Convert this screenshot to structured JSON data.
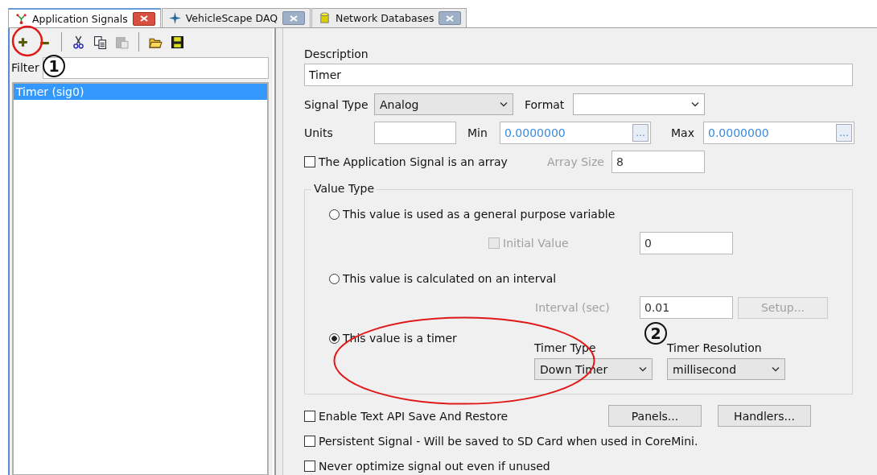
{
  "tabs": [
    {
      "label": "Application Signals",
      "kind": "signals",
      "selected": true
    },
    {
      "label": "VehicleScape DAQ",
      "kind": "daq",
      "selected": false
    },
    {
      "label": "Network Databases",
      "kind": "database",
      "selected": false
    }
  ],
  "toolbar": [
    {
      "kind": "add",
      "disabled": false
    },
    {
      "kind": "remove",
      "disabled": false
    },
    {
      "kind": "cut",
      "disabled": false
    },
    {
      "kind": "copy",
      "disabled": false
    },
    {
      "kind": "paste",
      "disabled": true
    },
    {
      "kind": "open",
      "disabled": false
    },
    {
      "kind": "save",
      "disabled": false
    }
  ],
  "filter": {
    "label": "Filter"
  },
  "signals": [
    {
      "label": "Timer (sig0)",
      "selected": true
    }
  ],
  "description": {
    "label": "Description",
    "value": "Timer"
  },
  "signal_type": {
    "label": "Signal Type",
    "value": "Analog"
  },
  "format": {
    "label": "Format"
  },
  "units": {
    "label": "Units"
  },
  "min": {
    "label": "Min",
    "value": "0.0000000",
    "button": "..."
  },
  "max": {
    "label": "Max",
    "value": "0.0000000",
    "button": "..."
  },
  "array": {
    "label": "The Application Signal is an array",
    "checked": false
  },
  "array_size": {
    "label": "Array Size",
    "value": "8",
    "disabled": true
  },
  "value_type": {
    "title": "Value Type",
    "options": [
      {
        "label": "This value is used as a general purpose variable",
        "selected": false
      },
      {
        "label": "This value is calculated on an interval",
        "selected": false
      },
      {
        "label": "This value is a timer",
        "selected": true
      }
    ],
    "initial_value": {
      "label": "Initial Value",
      "checked": false,
      "disabled": true,
      "value": "0"
    },
    "interval": {
      "label": "Interval (sec)",
      "value": "0.01",
      "disabled": true,
      "button": "Setup..."
    },
    "timer_type": {
      "label": "Timer Type",
      "value": "Down Timer"
    },
    "timer_resolution": {
      "label": "Timer Resolution",
      "value": "millisecond"
    }
  },
  "options": [
    {
      "label": "Enable Text API Save And Restore",
      "checked": false
    },
    {
      "label": "Persistent Signal - Will be saved to SD Card when used in CoreMini.",
      "checked": false
    },
    {
      "label": "Never optimize signal out even if unused",
      "checked": false
    }
  ],
  "buttons": [
    "Panels...",
    "Handlers..."
  ],
  "annotations": [
    {
      "label": "1"
    },
    {
      "label": "2"
    }
  ]
}
